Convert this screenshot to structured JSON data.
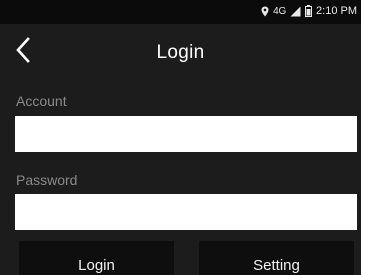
{
  "status_bar": {
    "network": "4G",
    "time": "2:10 PM",
    "icons": [
      "location-icon",
      "signal-icon",
      "battery-icon"
    ]
  },
  "header": {
    "title": "Login",
    "back_icon": "chevron-left-icon"
  },
  "form": {
    "account": {
      "label": "Account",
      "value": "",
      "placeholder": ""
    },
    "password": {
      "label": "Password",
      "value": "",
      "placeholder": ""
    }
  },
  "actions": {
    "login_label": "Login",
    "setting_label": "Setting"
  },
  "colors": {
    "background": "#1c1c1c",
    "status_bar": "#0b0b0b",
    "button": "#0e0e0e",
    "label": "#8a8a8a",
    "input": "#ffffff"
  }
}
